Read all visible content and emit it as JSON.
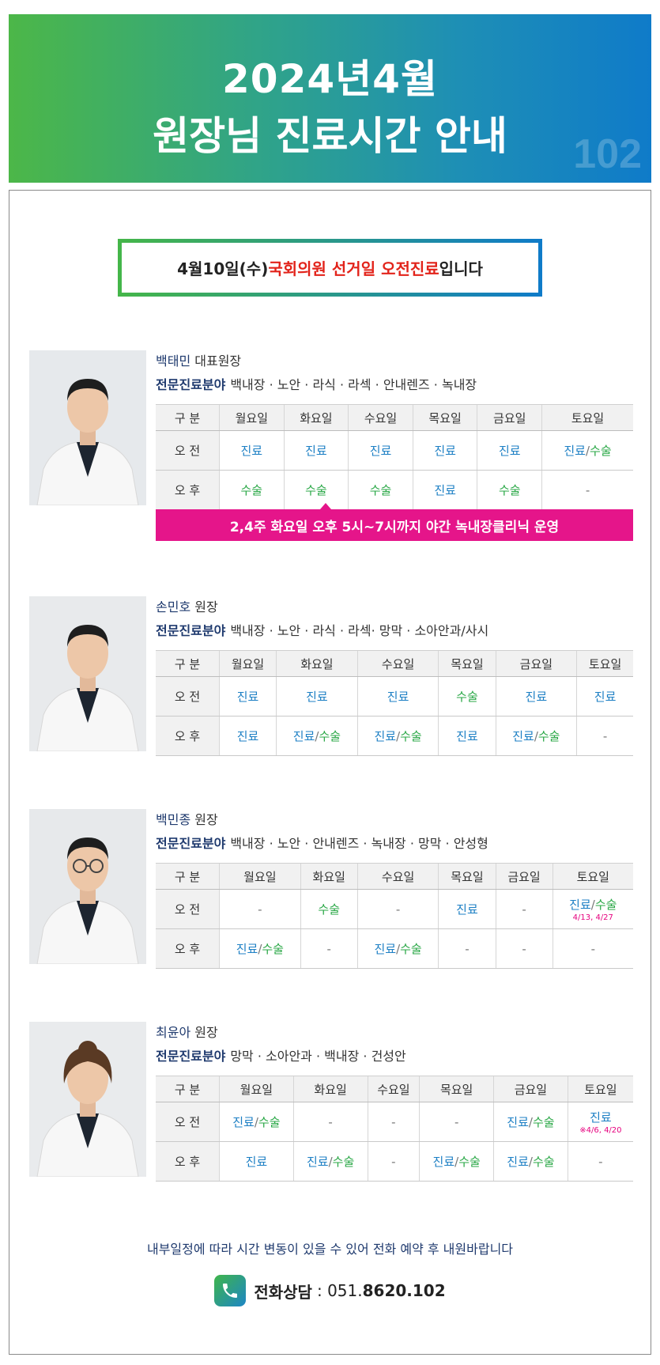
{
  "banner": {
    "title_line1": "2024년4월",
    "title_line2": "원장님 진료시간 안내",
    "watermark": "102"
  },
  "notice": {
    "prefix": "4월10일(수) ",
    "highlight": "국회의원 선거일 오전진료",
    "suffix": "입니다"
  },
  "table_header": {
    "label": "구 분",
    "days": [
      "월요일",
      "화요일",
      "수요일",
      "목요일",
      "금요일",
      "토요일"
    ]
  },
  "row_labels": {
    "am": "오 전",
    "pm": "오 후"
  },
  "doctors": [
    {
      "name": "백태민",
      "title": " 대표원장",
      "spec_label": "전문진료분야",
      "specialties": "백내장 · 노안 · 라식 · 라섹 · 안내렌즈 · 녹내장",
      "am": [
        [
          "진료",
          "",
          "blue"
        ],
        [
          "진료",
          "",
          "blue"
        ],
        [
          "진료",
          "",
          "blue"
        ],
        [
          "진료",
          "",
          "blue"
        ],
        [
          "진료",
          "",
          "blue"
        ],
        [
          "진료/수술",
          "",
          "mix"
        ]
      ],
      "pm": [
        [
          "수술",
          "",
          "green"
        ],
        [
          "수술",
          "",
          "green"
        ],
        [
          "수술",
          "",
          "green"
        ],
        [
          "진료",
          "",
          "blue"
        ],
        [
          "수술",
          "",
          "green"
        ],
        [
          "-",
          "",
          "dash"
        ]
      ],
      "banner": "2,4주 화요일 오후 5시~7시까지 야간 녹내장클리닉 운영"
    },
    {
      "name": "손민호",
      "title": " 원장",
      "spec_label": "전문진료분야",
      "specialties": "백내장 · 노안 · 라식 · 라섹· 망막 · 소아안과/사시",
      "am": [
        [
          "진료",
          "",
          "blue"
        ],
        [
          "진료",
          "",
          "blue"
        ],
        [
          "진료",
          "",
          "blue"
        ],
        [
          "수술",
          "",
          "green"
        ],
        [
          "진료",
          "",
          "blue"
        ],
        [
          "진료",
          "",
          "blue"
        ]
      ],
      "pm": [
        [
          "진료",
          "",
          "blue"
        ],
        [
          "진료/수술",
          "",
          "mix"
        ],
        [
          "진료/수술",
          "",
          "mix"
        ],
        [
          "진료",
          "",
          "blue"
        ],
        [
          "진료/수술",
          "",
          "mix"
        ],
        [
          "-",
          "",
          "dash"
        ]
      ]
    },
    {
      "name": "백민종",
      "title": " 원장",
      "spec_label": "전문진료분야",
      "specialties": "백내장 · 노안 · 안내렌즈 · 녹내장 · 망막 · 안성형",
      "am": [
        [
          "-",
          "",
          "dash"
        ],
        [
          "수술",
          "",
          "green"
        ],
        [
          "-",
          "",
          "dash"
        ],
        [
          "진료",
          "",
          "blue"
        ],
        [
          "-",
          "",
          "dash"
        ],
        [
          "진료/수술",
          "4/13, 4/27",
          "mix"
        ]
      ],
      "pm": [
        [
          "진료/수술",
          "",
          "mix"
        ],
        [
          "-",
          "",
          "dash"
        ],
        [
          "진료/수술",
          "",
          "mix"
        ],
        [
          "-",
          "",
          "dash"
        ],
        [
          "-",
          "",
          "dash"
        ],
        [
          "-",
          "",
          "dash"
        ]
      ]
    },
    {
      "name": "최윤아",
      "title": " 원장",
      "spec_label": "전문진료분야",
      "specialties": "망막 · 소아안과 · 백내장 · 건성안",
      "am": [
        [
          "진료/수술",
          "",
          "mix"
        ],
        [
          "-",
          "",
          "dash"
        ],
        [
          "-",
          "",
          "dash"
        ],
        [
          "-",
          "",
          "dash"
        ],
        [
          "진료/수술",
          "",
          "mix"
        ],
        [
          "진료",
          "※4/6, 4/20",
          "blue"
        ]
      ],
      "pm": [
        [
          "진료",
          "",
          "blue"
        ],
        [
          "진료/수술",
          "",
          "mix"
        ],
        [
          "-",
          "",
          "dash"
        ],
        [
          "진료/수술",
          "",
          "mix"
        ],
        [
          "진료/수술",
          "",
          "mix"
        ],
        [
          "-",
          "",
          "dash"
        ]
      ]
    }
  ],
  "footer": {
    "note": "내부일정에 따라 시간 변동이 있을 수 있어 전화 예약 후 내원바랍니다",
    "phone_label": "전화상담",
    "phone_sep": " : 051.",
    "phone_bold": "8620.102"
  }
}
